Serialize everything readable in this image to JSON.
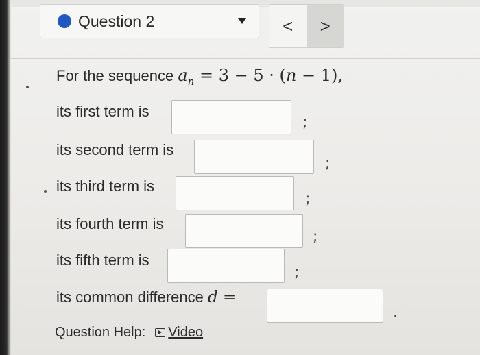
{
  "header": {
    "question_label": "Question 2",
    "prev_label": "<",
    "next_label": ">",
    "status_color": "#1e57c6"
  },
  "problem": {
    "intro": "For the sequence",
    "formula": {
      "lhs_var": "a",
      "lhs_sub": "n",
      "rhs": "= 3 − 5 · (",
      "rhs_var": "n",
      "rhs_tail": " − 1),"
    },
    "prompts": [
      {
        "label": "its first term is",
        "value": "",
        "separator": ";"
      },
      {
        "label": "its second term is",
        "value": "",
        "separator": ";"
      },
      {
        "label": "its third term is",
        "value": "",
        "separator": ";"
      },
      {
        "label": "its fourth term is",
        "value": "",
        "separator": ";"
      },
      {
        "label": "its fifth term is",
        "value": "",
        "separator": ";"
      }
    ],
    "common_difference": {
      "label": "its common difference",
      "var": "d",
      "equals": "=",
      "value": "",
      "end": "."
    }
  },
  "help": {
    "label": "Question Help:",
    "video_label": "Video",
    "video_icon": "play-icon"
  }
}
